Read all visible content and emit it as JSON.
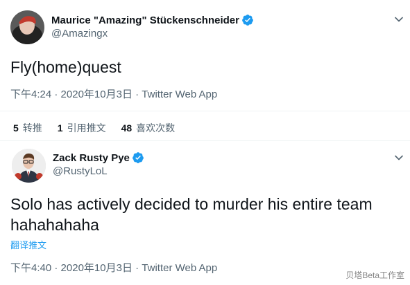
{
  "tweet1": {
    "display_name": "Maurice \"Amazing\" Stückenschneider",
    "handle": "@Amazingx",
    "text": "Fly(home)quest",
    "time": "下午4:24",
    "date": "2020年10月3日",
    "source": "Twitter Web App",
    "separator": "·",
    "verified_icon": "verified-badge-icon",
    "menu_icon": "chevron-down-icon"
  },
  "stats": {
    "retweets_count": "5",
    "retweets_label": "转推",
    "quotes_count": "1",
    "quotes_label": "引用推文",
    "likes_count": "48",
    "likes_label": "喜欢次数"
  },
  "tweet2": {
    "display_name": "Zack Rusty Pye",
    "handle": "@RustyLoL",
    "text": "Solo has actively decided to murder his entire team hahahahaha",
    "translate_label": "翻译推文",
    "time": "下午4:40",
    "date": "2020年10月3日",
    "source": "Twitter Web App",
    "separator": "·",
    "verified_icon": "verified-badge-icon",
    "menu_icon": "chevron-down-icon"
  },
  "watermark": "贝塔Beta工作室",
  "colors": {
    "accent": "#1d9bf0",
    "secondary_text": "#536471",
    "primary_text": "#0f1419",
    "divider": "#eff3f4"
  }
}
